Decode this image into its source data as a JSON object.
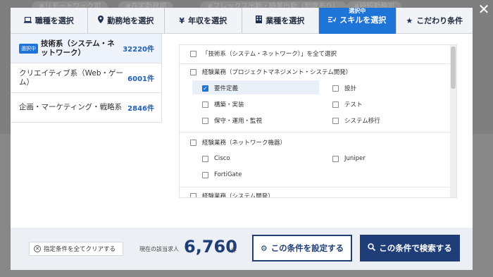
{
  "background_tags": [
    "#リモートワーク可",
    "#在宅勤務可",
    "#フレックス出勤・時差出勤（制度あり）",
    "#時短勤務可"
  ],
  "tabs": [
    {
      "label": "職種を選択",
      "icon": "laptop-icon"
    },
    {
      "label": "勤務地を選択",
      "icon": "pin-icon"
    },
    {
      "label": "年収を選択",
      "icon": "yen-icon"
    },
    {
      "label": "業種を選択",
      "icon": "building-icon"
    },
    {
      "label": "スキルを選択",
      "icon": "skill-icon",
      "sub": "選択中"
    },
    {
      "label": "こだわり条件",
      "icon": "star-icon"
    }
  ],
  "categories": [
    {
      "badge": "選択中",
      "label": "技術系（システム・ネットワーク）",
      "count": "32220件"
    },
    {
      "label": "クリエイティブ系（Web・ゲーム）",
      "count": "6001件"
    },
    {
      "label": "企画・マーケティング・戦略系",
      "count": "2846件"
    }
  ],
  "panel": {
    "select_all": "「技術系（システム・ネットワーク）」を全て選択",
    "groups": [
      {
        "title": "経験業務（プロジェクトマネジメント・システム開発）",
        "items": [
          {
            "label": "要件定義",
            "checked": true
          },
          {
            "label": "設計",
            "checked": false
          },
          {
            "label": "構築・実装",
            "checked": false
          },
          {
            "label": "テスト",
            "checked": false
          },
          {
            "label": "保守・運用・監視",
            "checked": false
          },
          {
            "label": "システム移行",
            "checked": false
          }
        ]
      },
      {
        "title": "経験業務（ネットワーク機器）",
        "items": [
          {
            "label": "Cisco",
            "checked": false
          },
          {
            "label": "Juniper",
            "checked": false
          },
          {
            "label": "FortiGate",
            "checked": false
          }
        ]
      },
      {
        "title": "経験業務（システム開発）",
        "items": []
      }
    ]
  },
  "footer": {
    "clear_label": "指定条件を全てクリアする",
    "count_label": "現在の該当求人",
    "count_value": "6,760",
    "count_unit": "件",
    "set_label": "この条件を設定する",
    "search_label": "この条件で検索する"
  },
  "colors": {
    "accent": "#1f74d8",
    "navy": "#1f3e78"
  }
}
